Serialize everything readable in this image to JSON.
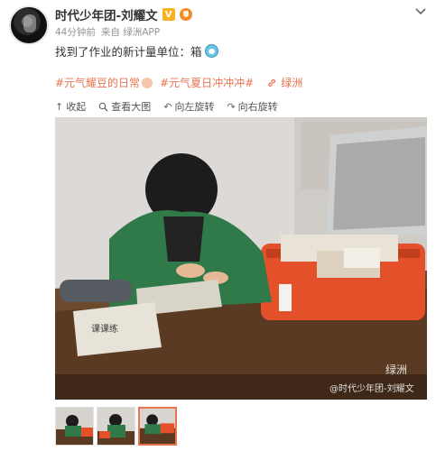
{
  "user": {
    "name": "时代少年团-刘耀文",
    "vip_badge": "V"
  },
  "meta": {
    "time": "44分钟前",
    "source": "来自 绿洲APP"
  },
  "post": {
    "text": "找到了作业的新计量单位：箱"
  },
  "tags": [
    {
      "label": "#元气耀豆的日常"
    },
    {
      "label": "#元气夏日冲冲冲#"
    }
  ],
  "location": "绿洲",
  "toolbar": {
    "collapse": "收起",
    "view_large": "查看大图",
    "rotate_left": "向左旋转",
    "rotate_right": "向右旋转"
  },
  "photo": {
    "watermark_logo": "绿洲",
    "watermark_text": "@时代少年团-刘耀文",
    "paper_text": "课课练"
  },
  "thumbnails": [
    {
      "active": false
    },
    {
      "active": false
    },
    {
      "active": true
    }
  ],
  "colors": {
    "accent": "#eb7350",
    "vip": "#f7b321",
    "suitcase": "#e4502a"
  }
}
